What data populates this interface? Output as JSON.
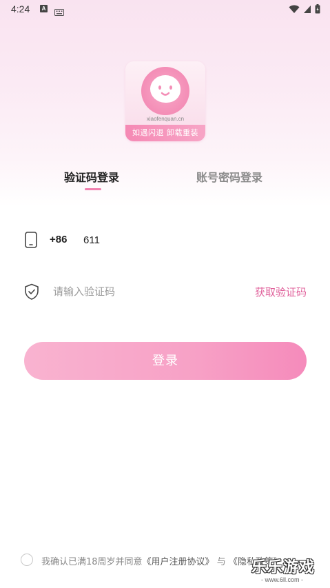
{
  "status_bar": {
    "time": "4:24",
    "icons": [
      "a-notification-icon",
      "keyboard-icon",
      "wifi-icon",
      "signal-icon",
      "battery-icon"
    ]
  },
  "logo": {
    "site": "xiaofenquan.cn",
    "banner": "如遇闪退  卸载重装"
  },
  "tabs": [
    {
      "label": "验证码登录",
      "active": true
    },
    {
      "label": "账号密码登录",
      "active": false
    }
  ],
  "phone": {
    "country_code": "+86",
    "value": "611"
  },
  "code": {
    "placeholder": "请输入验证码",
    "get_code_label": "获取验证码"
  },
  "login_button": "登录",
  "agreement": {
    "prefix": "我确认已满18周岁并同意",
    "user_agreement": "《用户注册协议》",
    "conjunction": "与",
    "privacy_policy": "《隐私政策》"
  },
  "watermark": {
    "main": "乐乐游戏",
    "sub": "- www.6ll.com -"
  },
  "colors": {
    "accent": "#e05f9a",
    "button": "#f7a1c6",
    "indicator": "#f07fae"
  }
}
